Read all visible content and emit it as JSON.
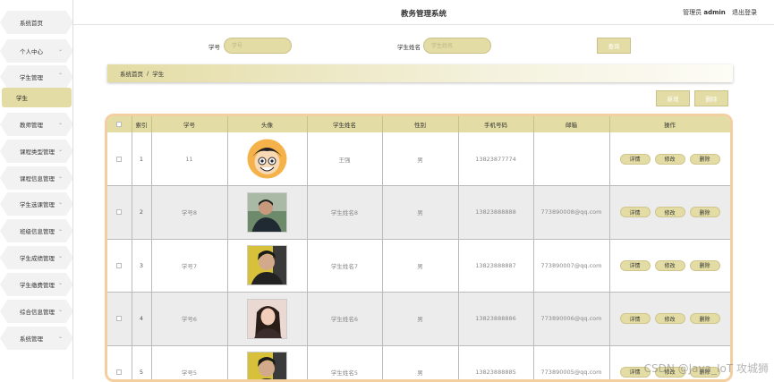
{
  "header": {
    "site_title": "教务管理系统",
    "user_label": "管理员",
    "username": "admin",
    "logout": "退出登录"
  },
  "sidebar": {
    "items": [
      {
        "label": "系统首页",
        "chevron": false
      },
      {
        "label": "个人中心",
        "chevron": true
      },
      {
        "label": "学生管理",
        "chevron": true
      },
      {
        "label": "学生",
        "chevron": false,
        "active": true
      },
      {
        "label": "教师管理",
        "chevron": true
      },
      {
        "label": "课程类型管理",
        "chevron": true
      },
      {
        "label": "课程信息管理",
        "chevron": true
      },
      {
        "label": "学生选课管理",
        "chevron": true
      },
      {
        "label": "班级信息管理",
        "chevron": true
      },
      {
        "label": "学生成绩管理",
        "chevron": true
      },
      {
        "label": "学生缴费管理",
        "chevron": true
      },
      {
        "label": "综合信息管理",
        "chevron": true
      },
      {
        "label": "系统管理",
        "chevron": true
      }
    ]
  },
  "search": {
    "student_no_label": "学号",
    "student_no_placeholder": "学号",
    "student_name_label": "学生姓名",
    "student_name_placeholder": "学生姓名",
    "search_button": "查询"
  },
  "breadcrumb": {
    "home": "系统首页",
    "separator": "/",
    "current": "学生"
  },
  "actions": {
    "add": "新增",
    "delete": "删除"
  },
  "table": {
    "columns": [
      "索引",
      "学号",
      "头像",
      "学生姓名",
      "性别",
      "手机号码",
      "邮箱",
      "操作"
    ],
    "op_labels": {
      "detail": "详情",
      "edit": "修改",
      "delete": "删除"
    },
    "rows": [
      {
        "index": "1",
        "student_no": "11",
        "avatar": "cartoon-avatar",
        "name": "王强",
        "gender": "男",
        "phone": "13823877774",
        "email": ""
      },
      {
        "index": "2",
        "student_no": "学号8",
        "avatar": "photo-avatar",
        "name": "学生姓名8",
        "gender": "男",
        "phone": "13823888888",
        "email": "773890008@qq.com"
      },
      {
        "index": "3",
        "student_no": "学号7",
        "avatar": "photo-avatar",
        "name": "学生姓名7",
        "gender": "男",
        "phone": "13823888887",
        "email": "773890007@qq.com"
      },
      {
        "index": "4",
        "student_no": "学号6",
        "avatar": "photo-avatar",
        "name": "学生姓名6",
        "gender": "男",
        "phone": "13823888886",
        "email": "773890006@qq.com"
      },
      {
        "index": "5",
        "student_no": "学号5",
        "avatar": "photo-avatar",
        "name": "学生姓名5",
        "gender": "男",
        "phone": "13823888885",
        "email": "773890005@qq.com"
      }
    ]
  },
  "watermark": "CSDN @Java_IoT 攻城狮",
  "colors": {
    "accent": "#e3dca4",
    "table_border": "#f3cfa0"
  }
}
